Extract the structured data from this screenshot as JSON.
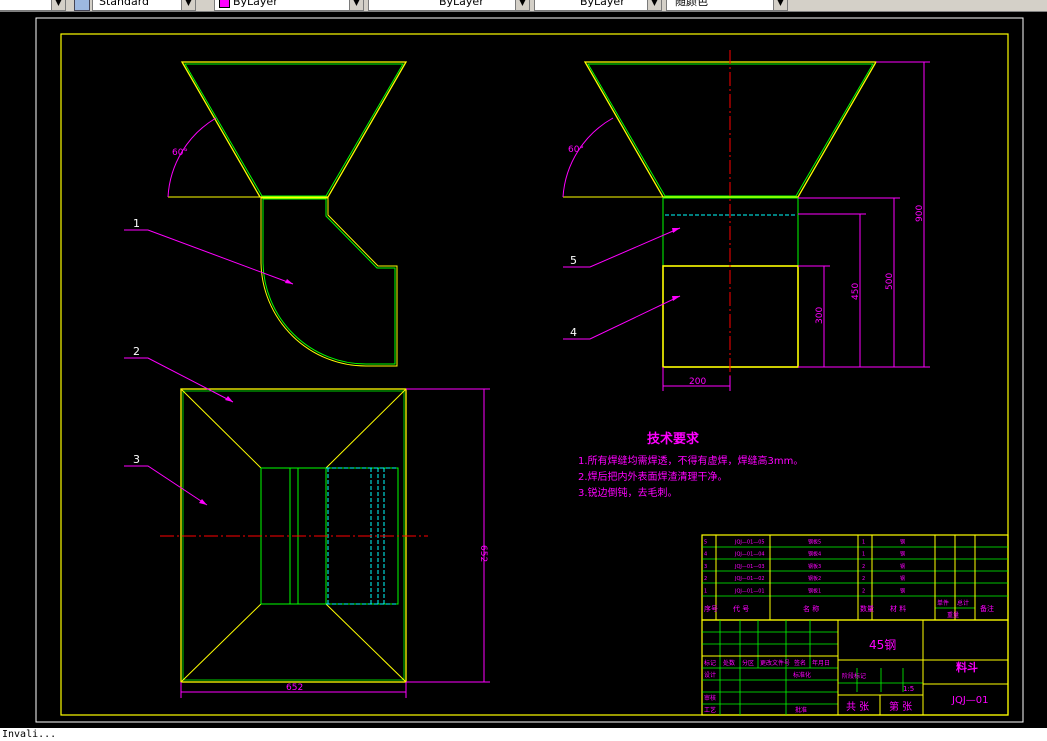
{
  "toolbar": {
    "textstyle": "Standard",
    "layer": "ByLayer",
    "linetype": "ByLayer",
    "lineweight": "ByLayer",
    "plotstyle": "随颜色"
  },
  "colors": {
    "yellow": "#ffff00",
    "green": "#00ff00",
    "cyan": "#00ffff",
    "magenta": "#ff00ff",
    "red": "#ff0000",
    "background": "#000000"
  },
  "drawing": {
    "angle_front": "60°",
    "angle_side": "60°",
    "balloons": [
      "1",
      "2",
      "3",
      "4",
      "5"
    ],
    "dims": {
      "d900": "900",
      "d500": "500",
      "d450": "450",
      "d300": "300",
      "d200": "200",
      "d652_width": "652",
      "d652_height": "652"
    }
  },
  "tech_requirements": {
    "title": "技术要求",
    "lines": [
      "1.所有焊缝均需焊透，不得有虚焊，焊缝高3mm。",
      "2.焊后把内外表面焊渣清理干净。",
      "3.锐边倒钝，去毛刺。"
    ]
  },
  "title_block": {
    "material": "45钢",
    "part_name": "料斗",
    "drawing_no": "JQJ—01",
    "scale": "1:5",
    "sheet_total": "共 张",
    "sheet_no": "第 张",
    "parts_list": {
      "header": [
        "序号",
        "代 号",
        "名 称",
        "数量",
        "材 料",
        "单件",
        "总计",
        "备注"
      ],
      "header_weight": "重量",
      "rows": [
        {
          "no": "5",
          "code": "JQJ—01—05",
          "name": "钢板5",
          "qty": "1",
          "material": "钢"
        },
        {
          "no": "4",
          "code": "JQJ—01—04",
          "name": "钢板4",
          "qty": "1",
          "material": "钢"
        },
        {
          "no": "3",
          "code": "JQJ—01—03",
          "name": "钢板3",
          "qty": "2",
          "material": "钢"
        },
        {
          "no": "2",
          "code": "JQJ—01—02",
          "name": "钢板2",
          "qty": "2",
          "material": "钢"
        },
        {
          "no": "1",
          "code": "JQJ—01—01",
          "name": "钢板1",
          "qty": "2",
          "material": "钢"
        }
      ]
    },
    "labels": {
      "mark": "标记",
      "count": "处数",
      "zone": "分区",
      "change_doc": "更改文件号",
      "sign": "签名",
      "date": "年月日",
      "design": "设计",
      "standard": "标准化",
      "review": "审核",
      "process": "工艺",
      "approve": "批准",
      "stage_mark": "阶段标记"
    }
  },
  "command_line": "Invali..."
}
